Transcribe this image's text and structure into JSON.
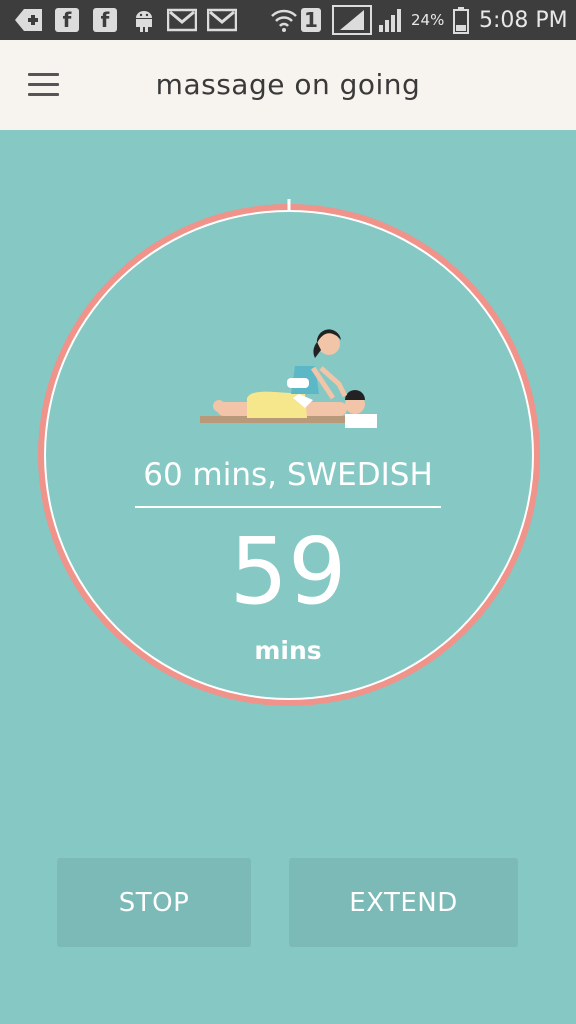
{
  "status_bar": {
    "icons": [
      "back-plus-icon",
      "facebook-icon",
      "facebook-icon",
      "android-icon",
      "gmail-icon",
      "gmail-icon",
      "wifi-icon",
      "sim1-icon",
      "signal-icon",
      "signal-icon",
      "battery-icon"
    ],
    "sim_label": "1",
    "battery_percent": "24%",
    "time": "5:08 PM"
  },
  "app_bar": {
    "title": "massage on going",
    "menu_icon": "hamburger-menu-icon"
  },
  "timer": {
    "session_label": "60 mins, SWEDISH",
    "minutes_remaining": "59",
    "unit_label": "mins",
    "progress_elapsed_fraction": 0.0167,
    "ring_color": "#f0938a",
    "inner_color": "#85c8c4",
    "illustration": "massage-illustration"
  },
  "buttons": {
    "stop_label": "STOP",
    "extend_label": "EXTEND"
  },
  "colors": {
    "background": "#85c8c4",
    "app_bar": "#f7f4ef",
    "button": "#7bbab6",
    "accent": "#f0938a"
  }
}
